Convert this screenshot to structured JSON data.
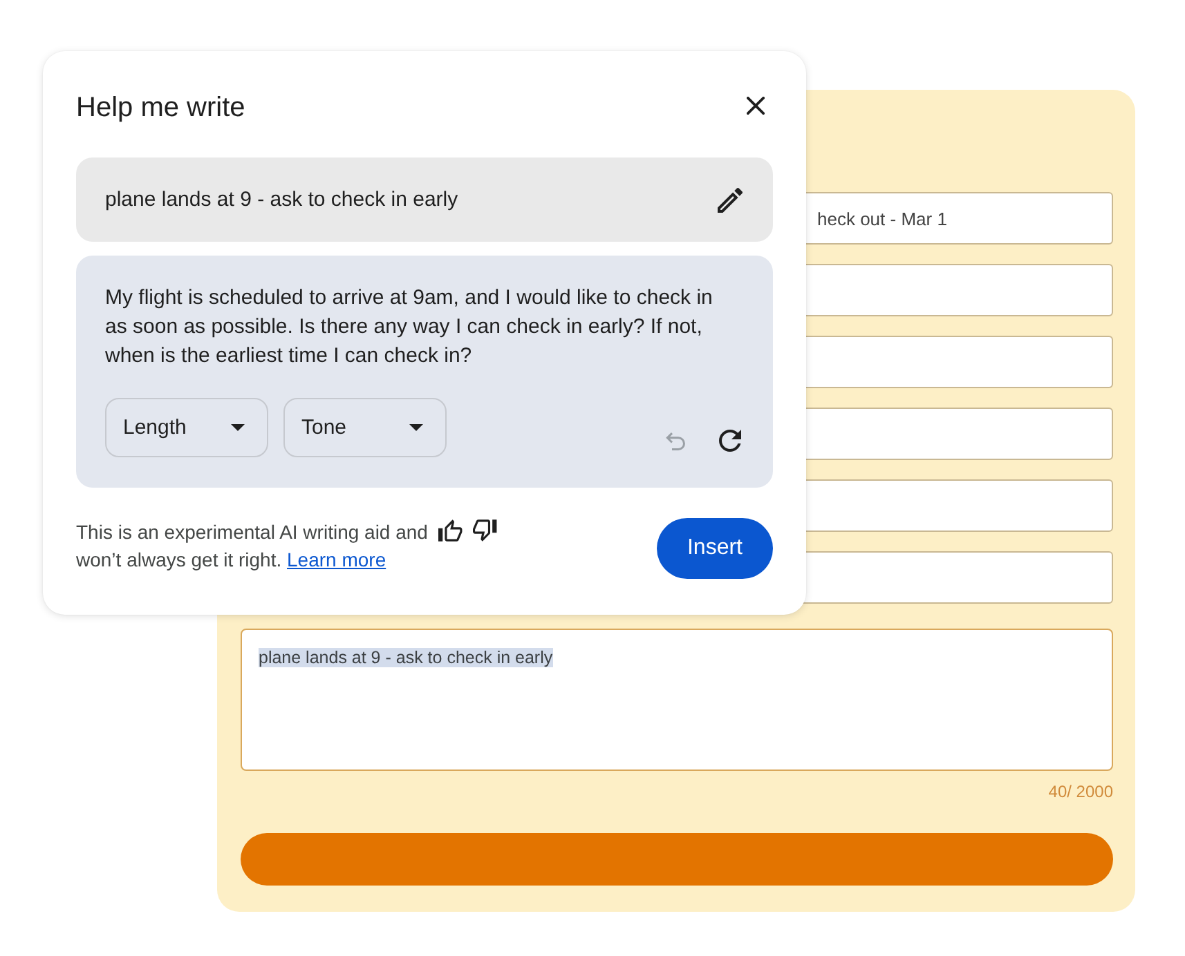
{
  "form": {
    "fields": [
      {
        "kind": "input",
        "value": "heck out - Mar 1"
      },
      {
        "kind": "input"
      },
      {
        "kind": "input"
      },
      {
        "kind": "input"
      },
      {
        "kind": "input"
      },
      {
        "kind": "input"
      },
      {
        "kind": "textarea",
        "value": "plane lands at 9 - ask to check in early",
        "highlighted": true
      }
    ],
    "counter": "40/ 2000"
  },
  "dialog": {
    "title": "Help me write",
    "prompt": "plane lands at 9 - ask to check in early",
    "draft": "My flight is scheduled to arrive at 9am, and I would like to check in as soon as possible. Is there any way I can check in early? If not, when is the earliest time I can check in?",
    "dropdowns": [
      {
        "label": "Length"
      },
      {
        "label": "Tone"
      }
    ],
    "undo": {
      "disabled": true
    },
    "disclaimer": "This is an experimental AI writing aid and won’t always get it right.",
    "learn_more": "Learn more",
    "insert": "Insert"
  }
}
